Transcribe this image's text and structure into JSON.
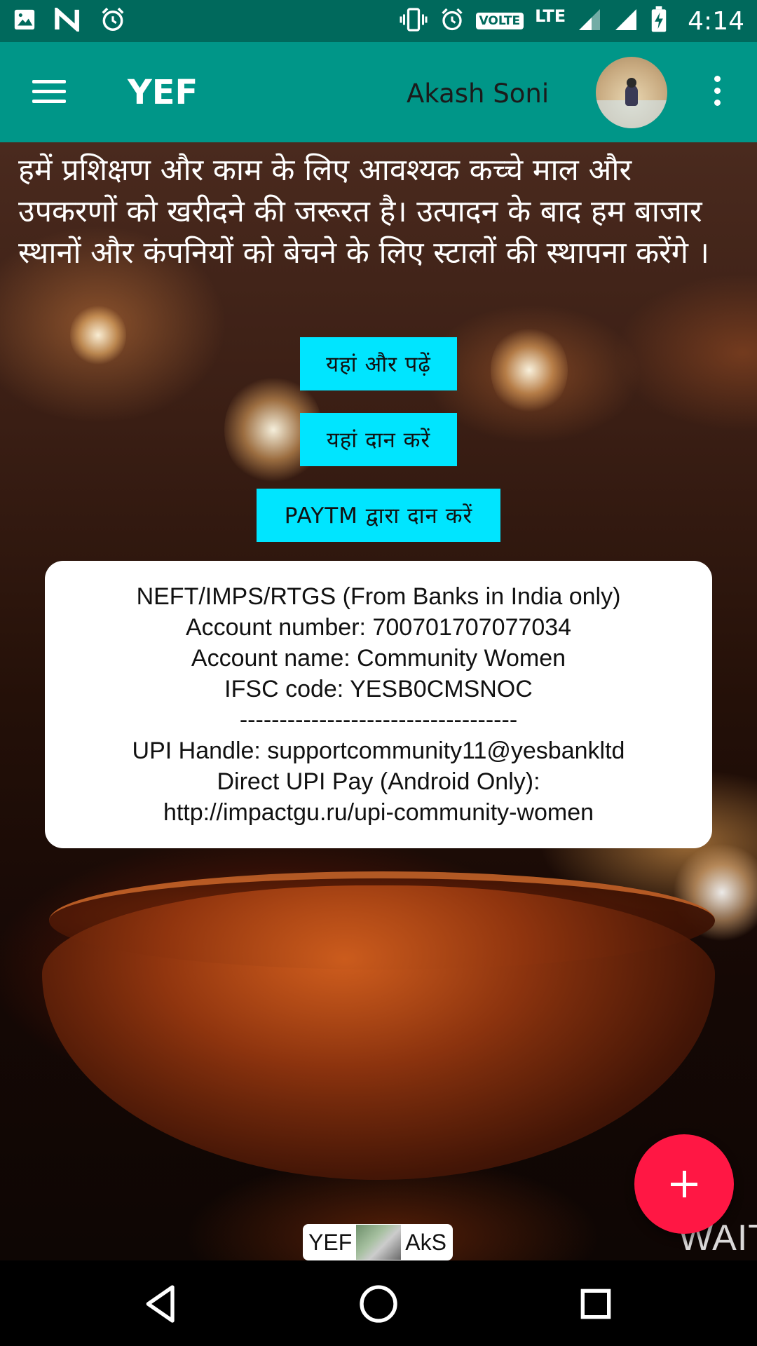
{
  "status_bar": {
    "left_icons": [
      "image-icon",
      "n-notification-icon",
      "alarm-icon"
    ],
    "right_icons": [
      "vibrate-icon",
      "alarm-icon",
      "signal-icon",
      "signal-icon",
      "battery-charging-icon"
    ],
    "volte": "VOLTE",
    "lte": "LTE",
    "time": "4:14"
  },
  "app_bar": {
    "title": "YEF",
    "user_name": "Akash Soni"
  },
  "content": {
    "intro_text": "हमें प्रशिक्षण और काम के लिए आवश्यक कच्चे माल और उपकरणों को खरीदने की जरूरत है। उत्पादन के बाद हम बाजार स्थानों और कंपनियों को बेचने के लिए स्टालों की स्थापना करेंगे ।",
    "buttons": {
      "read_more": "यहां और पढ़ें",
      "donate": "यहां दान करें",
      "paytm": "PAYTM द्वारा दान करें"
    },
    "bank_details": {
      "line1": "NEFT/IMPS/RTGS (From Banks in India only)",
      "line2": "Account number: 700701707077034",
      "line3": "Account name: Community Women",
      "line4": "IFSC code: YESB0CMSNOC",
      "separator": "-----------------------------------",
      "line5": "UPI Handle: supportcommunity11@yesbankltd",
      "line6": "Direct UPI Pay (Android Only):",
      "line7": "http://impactgu.ru/upi-community-women"
    }
  },
  "footer": {
    "badge_left": "YEF",
    "badge_right": "AkS",
    "overlay_text": "WAIT"
  },
  "colors": {
    "status_bar": "#00695c",
    "app_bar": "#009688",
    "cta": "#00e5ff",
    "fab": "#ff1744"
  }
}
